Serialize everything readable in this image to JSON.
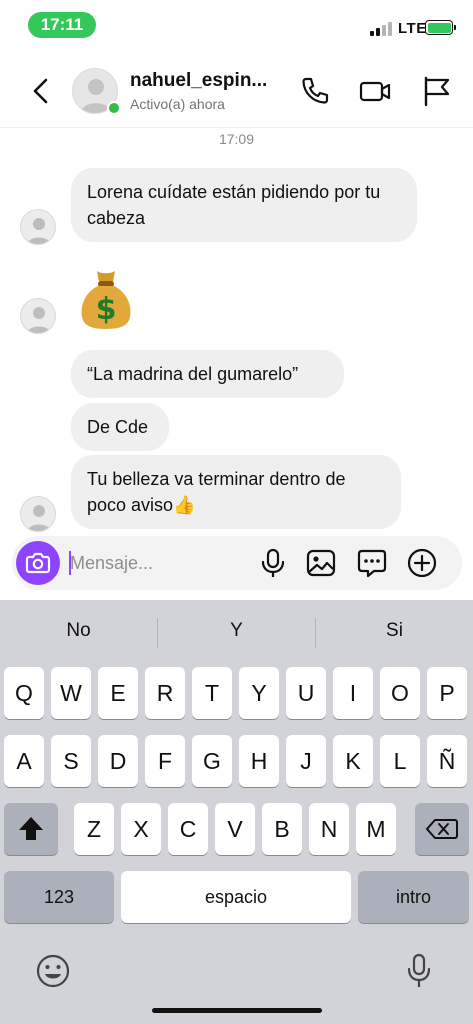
{
  "status_bar": {
    "time": "17:11",
    "network": "LTE"
  },
  "header": {
    "username": "nahuel_espin...",
    "status": "Activo(a) ahora"
  },
  "chat": {
    "timestamp": "17:09",
    "messages": [
      {
        "text": "Lorena cuídate están pidiendo por tu cabeza"
      },
      {
        "emoji": "money-bag"
      },
      {
        "text": "“La madrina del gumarelo”"
      },
      {
        "text": "De Cde"
      },
      {
        "text": "Tu belleza va terminar dentro de poco aviso👍"
      }
    ]
  },
  "composer": {
    "placeholder": "Mensaje..."
  },
  "keyboard": {
    "suggestions": [
      "No",
      "Y",
      "Si"
    ],
    "row1": [
      "Q",
      "W",
      "E",
      "R",
      "T",
      "Y",
      "U",
      "I",
      "O",
      "P"
    ],
    "row2": [
      "A",
      "S",
      "D",
      "F",
      "G",
      "H",
      "J",
      "K",
      "L",
      "Ñ"
    ],
    "row3": [
      "Z",
      "X",
      "C",
      "V",
      "B",
      "N",
      "M"
    ],
    "numbers_label": "123",
    "space_label": "espacio",
    "return_label": "intro"
  },
  "colors": {
    "accent": "#8e44ff",
    "online": "#2fbf47",
    "time_pill": "#34c759",
    "bubble": "#efefef"
  }
}
